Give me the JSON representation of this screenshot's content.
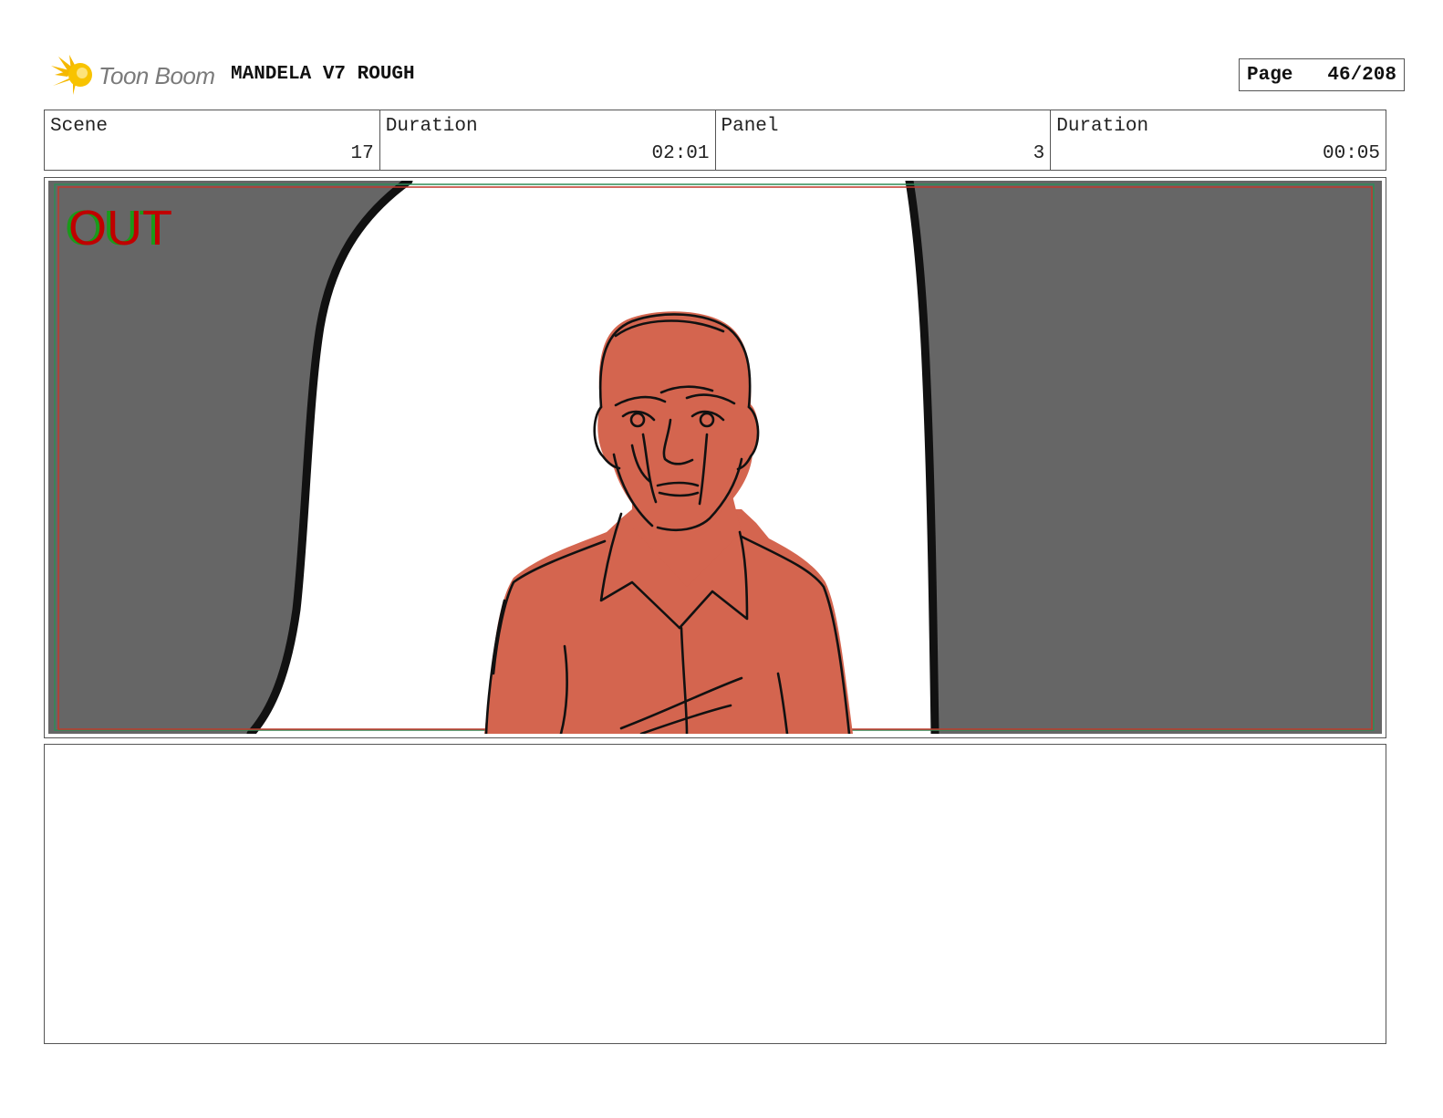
{
  "header": {
    "logo_text": "Toon Boom",
    "project_title": "MANDELA V7 ROUGH",
    "page_label": "Page",
    "page_number": "46/208"
  },
  "info": {
    "scene_label": "Scene",
    "scene_value": "17",
    "scene_duration_label": "Duration",
    "scene_duration_value": "02:01",
    "panel_label": "Panel",
    "panel_value": "3",
    "panel_duration_label": "Duration",
    "panel_duration_value": "00:05"
  },
  "panel": {
    "overlay_text": "OUT",
    "colors": {
      "door_gray": "#666666",
      "skin": "#d4654f",
      "ink": "#111111",
      "overlay_red": "#c00000",
      "overlay_green": "#1a9a1a",
      "safe_red": "#c0392b",
      "safe_green": "#2e8b57"
    }
  },
  "notes": {
    "text": ""
  }
}
